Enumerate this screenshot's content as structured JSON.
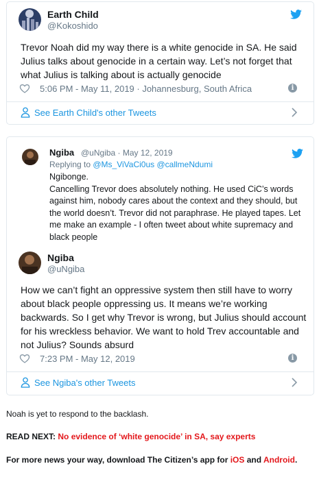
{
  "tweet1": {
    "author_name": "Earth Child",
    "author_handle": "@Kokoshido",
    "text": "Trevor Noah did my way there is a white genocide in SA. He said Julius talks about genocide in a certain way. Let’s not forget that what Julius is talking about is actually genocide",
    "timestamp": "5:06 PM - May 11, 2019 · Johannesburg, South Africa",
    "footer_link": "See Earth Child's other Tweets"
  },
  "tweet2": {
    "quoted": {
      "author_name": "Ngiba",
      "author_meta": "@uNgiba · May 12, 2019",
      "replying_prefix": "Replying to ",
      "replying_handles": "@Ms_ViVaCi0us @callmeNdumi",
      "text_line1": "Ngibonge.",
      "text_body": "Cancelling Trevor does absolutely nothing. He used CiC’s words against him, nobody cares about the context and they should, but the world doesn’t. Trevor did not paraphrase. He played tapes. Let me make an example - I often tweet about white supremacy and black people"
    },
    "author_name": "Ngiba",
    "author_handle": "@uNgiba",
    "text": "How we can’t fight an oppressive system then still have to worry about black people oppressing us. It means we’re working backwards. So I get why Trevor is wrong, but Julius should account for his wreckless behavior. We want to hold Trev accountable and not Julius? Sounds absurd",
    "timestamp": "7:23 PM - May 12, 2019",
    "footer_link": "See Ngiba's other Tweets"
  },
  "article": {
    "backlash_text": "Noah is yet to respond to the backlash.",
    "read_next_label": "READ NEXT:",
    "read_next_link": "No evidence of ‘white genocide’ in SA, say experts",
    "app_text": "For more news your way, download The Citizen’s app for ",
    "ios_link": "iOS",
    "and_text": " and ",
    "android_link": "Android",
    "period": "."
  },
  "colors": {
    "twitter_blue": "#1da1f2",
    "link_blue": "#1b95e0",
    "read_next_red": "#e3171b",
    "muted": "#657786"
  },
  "icons": [
    "twitter-bird-icon",
    "heart-icon",
    "info-icon",
    "person-icon",
    "chevron-right-icon"
  ]
}
